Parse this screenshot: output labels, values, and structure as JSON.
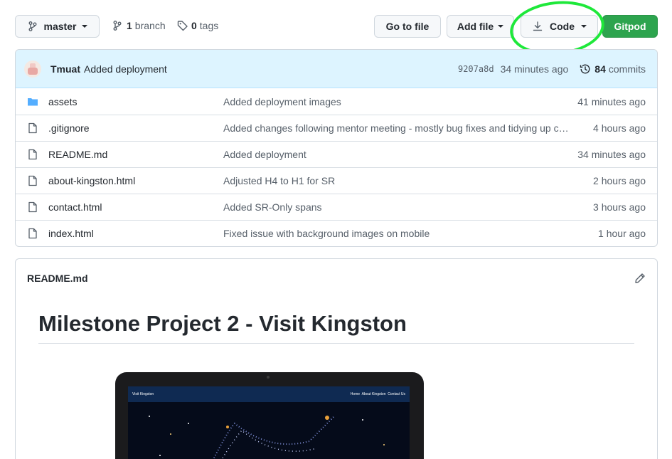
{
  "toolbar": {
    "branch_name": "master",
    "branch_count": "1",
    "branch_word": "branch",
    "tag_count": "0",
    "tag_word": "tags",
    "go_to_file": "Go to file",
    "add_file": "Add file",
    "code": "Code",
    "gitpod": "Gitpod"
  },
  "commit": {
    "author": "Tmuat",
    "message": "Added deployment",
    "sha": "9207a8d",
    "time": "34 minutes ago",
    "commit_count": "84",
    "commit_word": "commits"
  },
  "files": [
    {
      "name": "assets",
      "type": "folder",
      "message": "Added deployment images",
      "age": "41 minutes ago"
    },
    {
      "name": ".gitignore",
      "type": "file",
      "message": "Added changes following mentor meeting - mostly bug fixes and tidying up code",
      "age": "4 hours ago"
    },
    {
      "name": "README.md",
      "type": "file",
      "message": "Added deployment",
      "age": "34 minutes ago"
    },
    {
      "name": "about-kingston.html",
      "type": "file",
      "message": "Adjusted H4 to H1 for SR",
      "age": "2 hours ago"
    },
    {
      "name": "contact.html",
      "type": "file",
      "message": "Added SR-Only spans",
      "age": "3 hours ago"
    },
    {
      "name": "index.html",
      "type": "file",
      "message": "Fixed issue with background images on mobile",
      "age": "1 hour ago"
    }
  ],
  "readme": {
    "filename": "README.md",
    "heading": "Milestone Project 2 - Visit Kingston",
    "preview_site_title": "Visit Kingston",
    "preview_nav": [
      "Home",
      "About Kingston",
      "Contact Us"
    ]
  },
  "colors": {
    "accent_green": "#2da44e",
    "highlight_ring": "#1ee83a",
    "commit_bar_bg": "#ddf4ff",
    "folder_blue": "#54aeff"
  }
}
